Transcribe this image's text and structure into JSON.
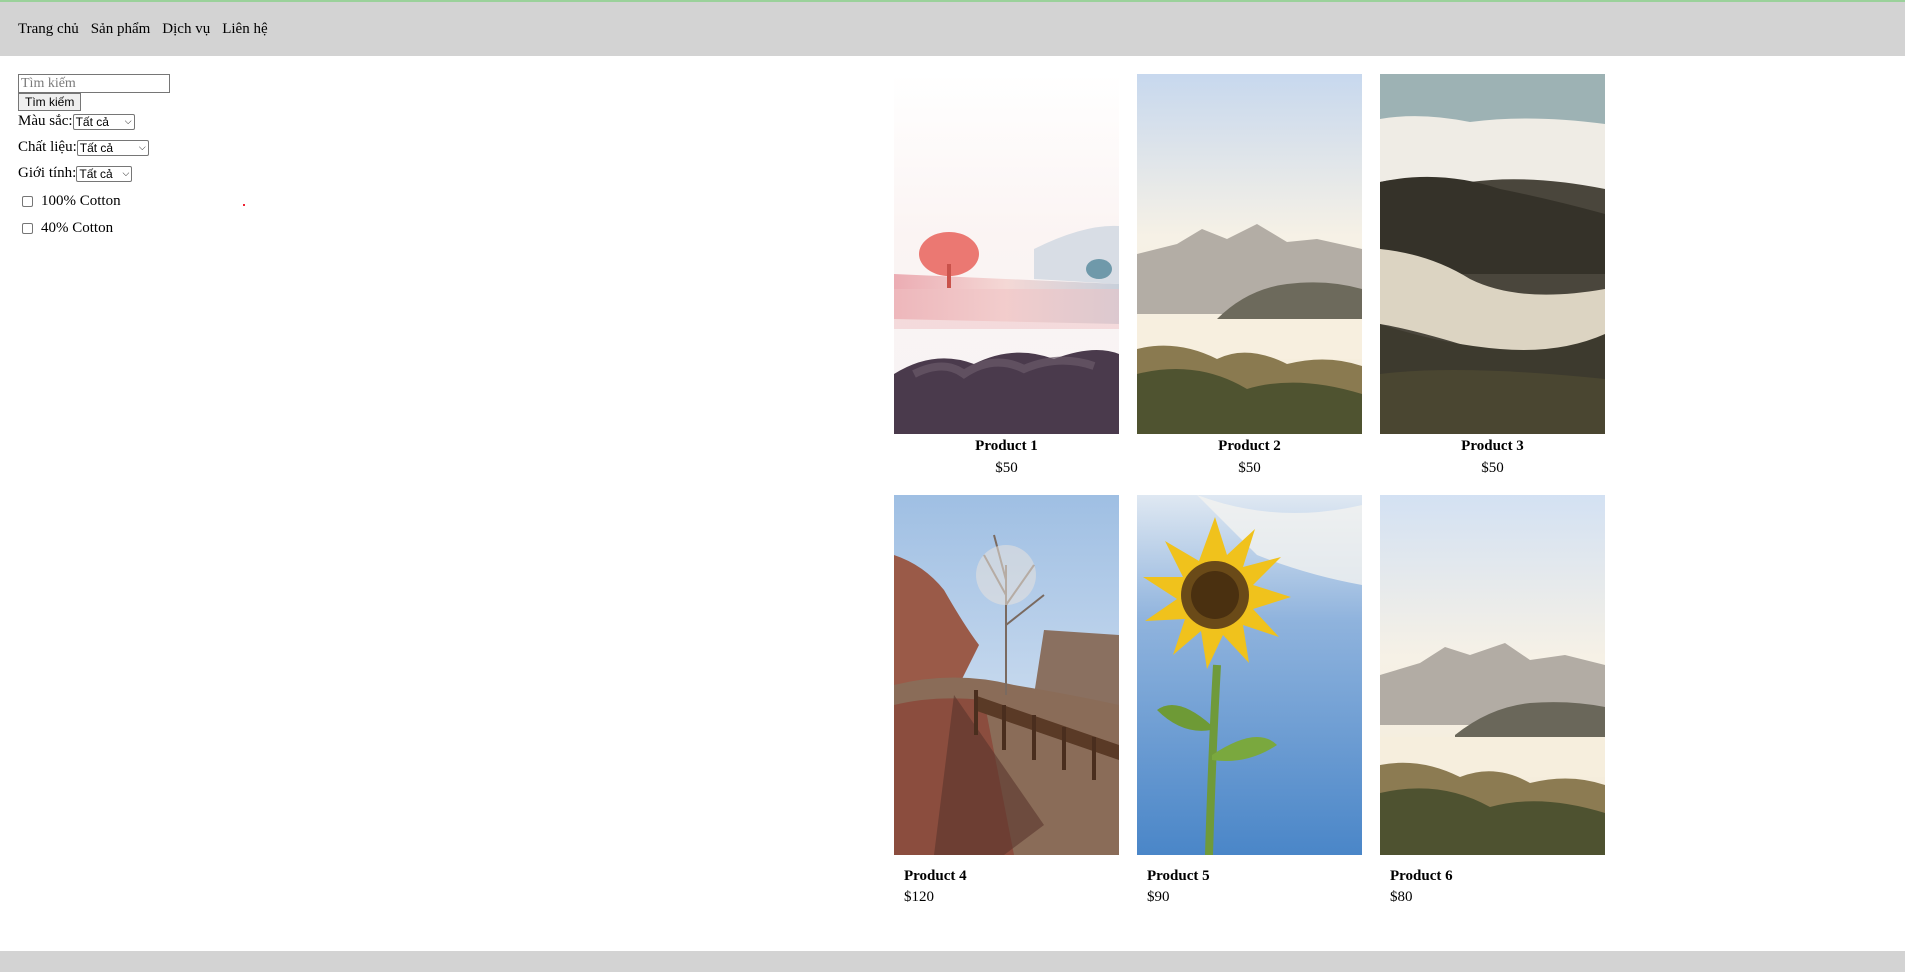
{
  "nav": {
    "items": [
      {
        "label": "Trang chủ"
      },
      {
        "label": "Sản phẩm"
      },
      {
        "label": "Dịch vụ"
      },
      {
        "label": "Liên hệ"
      }
    ]
  },
  "sidebar": {
    "search_placeholder": "Tìm kiếm",
    "search_button": "Tìm kiếm",
    "filters": [
      {
        "label": "Màu sắc:",
        "selected": "Tất cả"
      },
      {
        "label": "Chất liệu:",
        "selected": "Tất cả"
      },
      {
        "label": "Giới tính:",
        "selected": "Tất cả"
      }
    ],
    "checkboxes": [
      {
        "label": "100% Cotton",
        "checked": false
      },
      {
        "label": "40% Cotton",
        "checked": false
      }
    ]
  },
  "products": [
    {
      "name": "Product 1",
      "price": "$50",
      "image": "tree-on-misty-hill-photo"
    },
    {
      "name": "Product 2",
      "price": "$50",
      "image": "misty-mountain-valley-photo"
    },
    {
      "name": "Product 3",
      "price": "$50",
      "image": "clouds-over-mountains-photo"
    },
    {
      "name": "Product 4",
      "price": "$120",
      "image": "desert-path-with-tree-photo"
    },
    {
      "name": "Product 5",
      "price": "$90",
      "image": "sunflower-sky-photo"
    },
    {
      "name": "Product 6",
      "price": "$80",
      "image": "misty-mountain-valley-photo"
    }
  ]
}
